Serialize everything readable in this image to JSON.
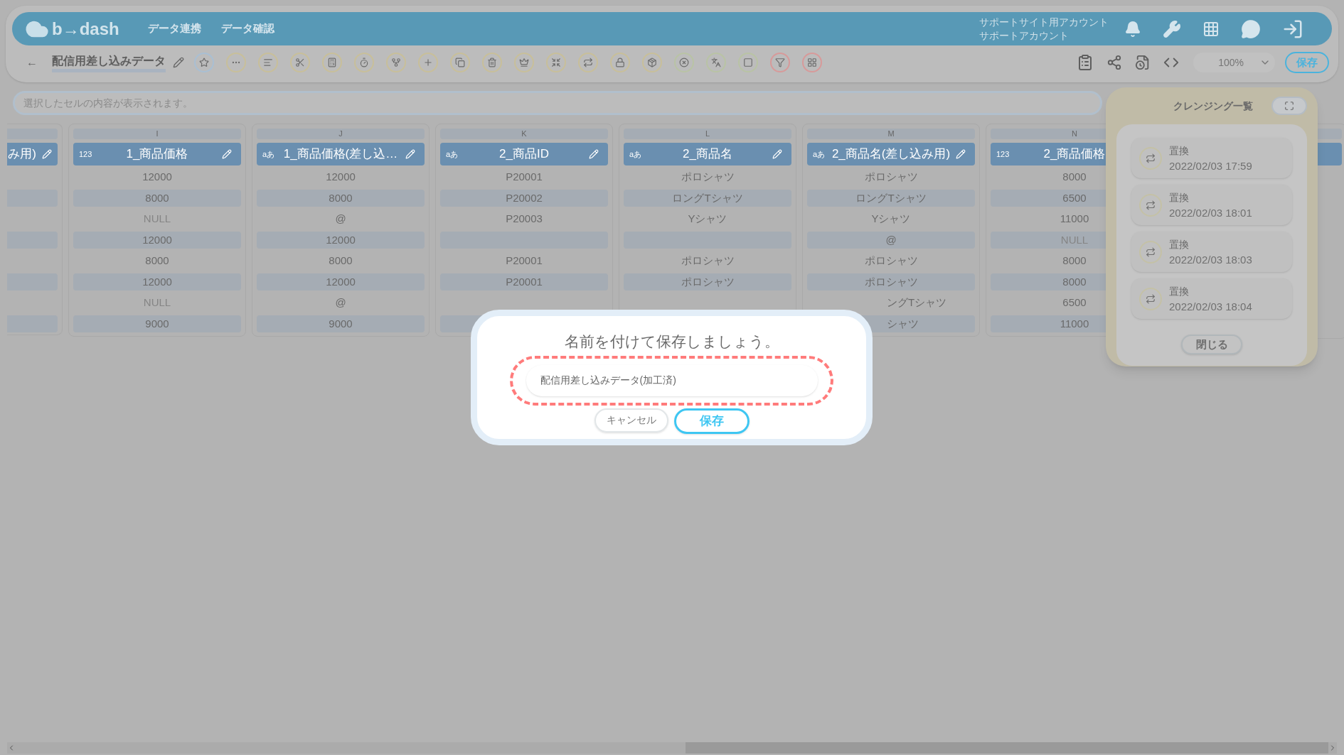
{
  "header": {
    "logo": "b→dash",
    "nav": [
      "データ連携",
      "データ確認"
    ],
    "account": [
      "サポートサイト用アカウント",
      "サポートアカウント"
    ]
  },
  "toolbar": {
    "back": "←",
    "title": "配信用差し込みデータ",
    "zoom": "100%",
    "save_button": "保存"
  },
  "formula_bar": {
    "placeholder": "選択したセルの内容が表示されます。"
  },
  "columns": [
    {
      "name": "み用)",
      "partial": true,
      "cells": [
        null,
        null,
        null,
        null,
        null,
        null,
        null,
        null
      ]
    },
    {
      "letter": "I",
      "type_badge": "123",
      "name": "1_商品価格",
      "cells": [
        "12000",
        "8000",
        {
          "text": "NULL",
          "kind": "null"
        },
        "12000",
        "8000",
        "12000",
        {
          "text": "NULL",
          "kind": "null"
        },
        "9000"
      ]
    },
    {
      "letter": "J",
      "type_badge": "aあ",
      "name": "1_商品価格(差し込…",
      "cells": [
        "12000",
        "8000",
        "@",
        "12000",
        "8000",
        "12000",
        "@",
        "9000"
      ]
    },
    {
      "letter": "K",
      "type_badge": "aあ",
      "name": "2_商品ID",
      "cells": [
        "P20001",
        "P20002",
        "P20003",
        null,
        "P20001",
        "P20001",
        null,
        null
      ]
    },
    {
      "letter": "L",
      "type_badge": "aあ",
      "name": "2_商品名",
      "cells": [
        "ポロシャツ",
        "ロングTシャツ",
        "Yシャツ",
        null,
        "ポロシャツ",
        "ポロシャツ"
      ]
    },
    {
      "letter": "M",
      "type_badge": "aあ",
      "name": "2_商品名(差し込み用)",
      "cells": [
        "ポロシャツ",
        "ロングTシャツ",
        "Yシャツ",
        "@",
        "ポロシャツ",
        "ポロシャツ",
        {
          "text": "ングTシャツ",
          "kind": "cut"
        },
        {
          "text": "シャツ",
          "kind": "cut"
        }
      ]
    },
    {
      "letter": "N",
      "type_badge": "123",
      "name": "2_商品価格",
      "cells": [
        "8000",
        "6500",
        "11000",
        {
          "text": "NULL",
          "kind": "null"
        },
        "8000",
        "8000",
        "6500",
        "11000"
      ]
    }
  ],
  "cleansing_panel": {
    "title": "クレンジング一覧",
    "items": [
      {
        "label": "置換",
        "time": "2022/02/03 17:59"
      },
      {
        "label": "置換",
        "time": "2022/02/03 18:01"
      },
      {
        "label": "置換",
        "time": "2022/02/03 18:03"
      },
      {
        "label": "置換",
        "time": "2022/02/03 18:04"
      }
    ],
    "close_button": "閉じる"
  },
  "dialog": {
    "title": "名前を付けて保存しましょう。",
    "value": "配信用差し込みデータ(加工済)",
    "cancel_button": "キャンセル",
    "save_button": "保存"
  }
}
